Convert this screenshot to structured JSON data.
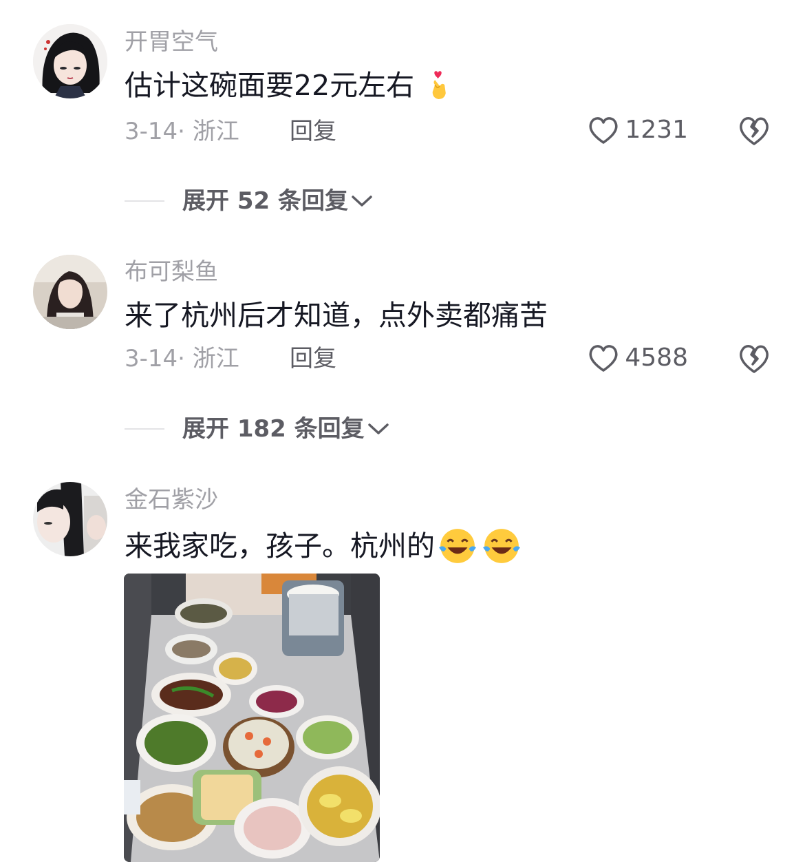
{
  "comments": [
    {
      "username": "开胃空气",
      "text": "估计这碗面要22元左右",
      "emoji": "crossed-fingers-heart-emoji",
      "date_location": "3-14· 浙江",
      "reply_label": "回复",
      "likes": "1231",
      "expand_label": "展开 52 条回复"
    },
    {
      "username": "布可梨鱼",
      "text": "来了杭州后才知道，点外卖都痛苦",
      "date_location": "3-14· 浙江",
      "reply_label": "回复",
      "likes": "4588",
      "expand_label": "展开 182 条回复"
    },
    {
      "username": "金石紫沙",
      "text": "来我家吃，孩子。杭州的",
      "emoji": "tears-of-joy-emoji"
    }
  ],
  "colors": {
    "username": "#a0a0a6",
    "text": "#161823",
    "secondary": "#5c5c63"
  }
}
